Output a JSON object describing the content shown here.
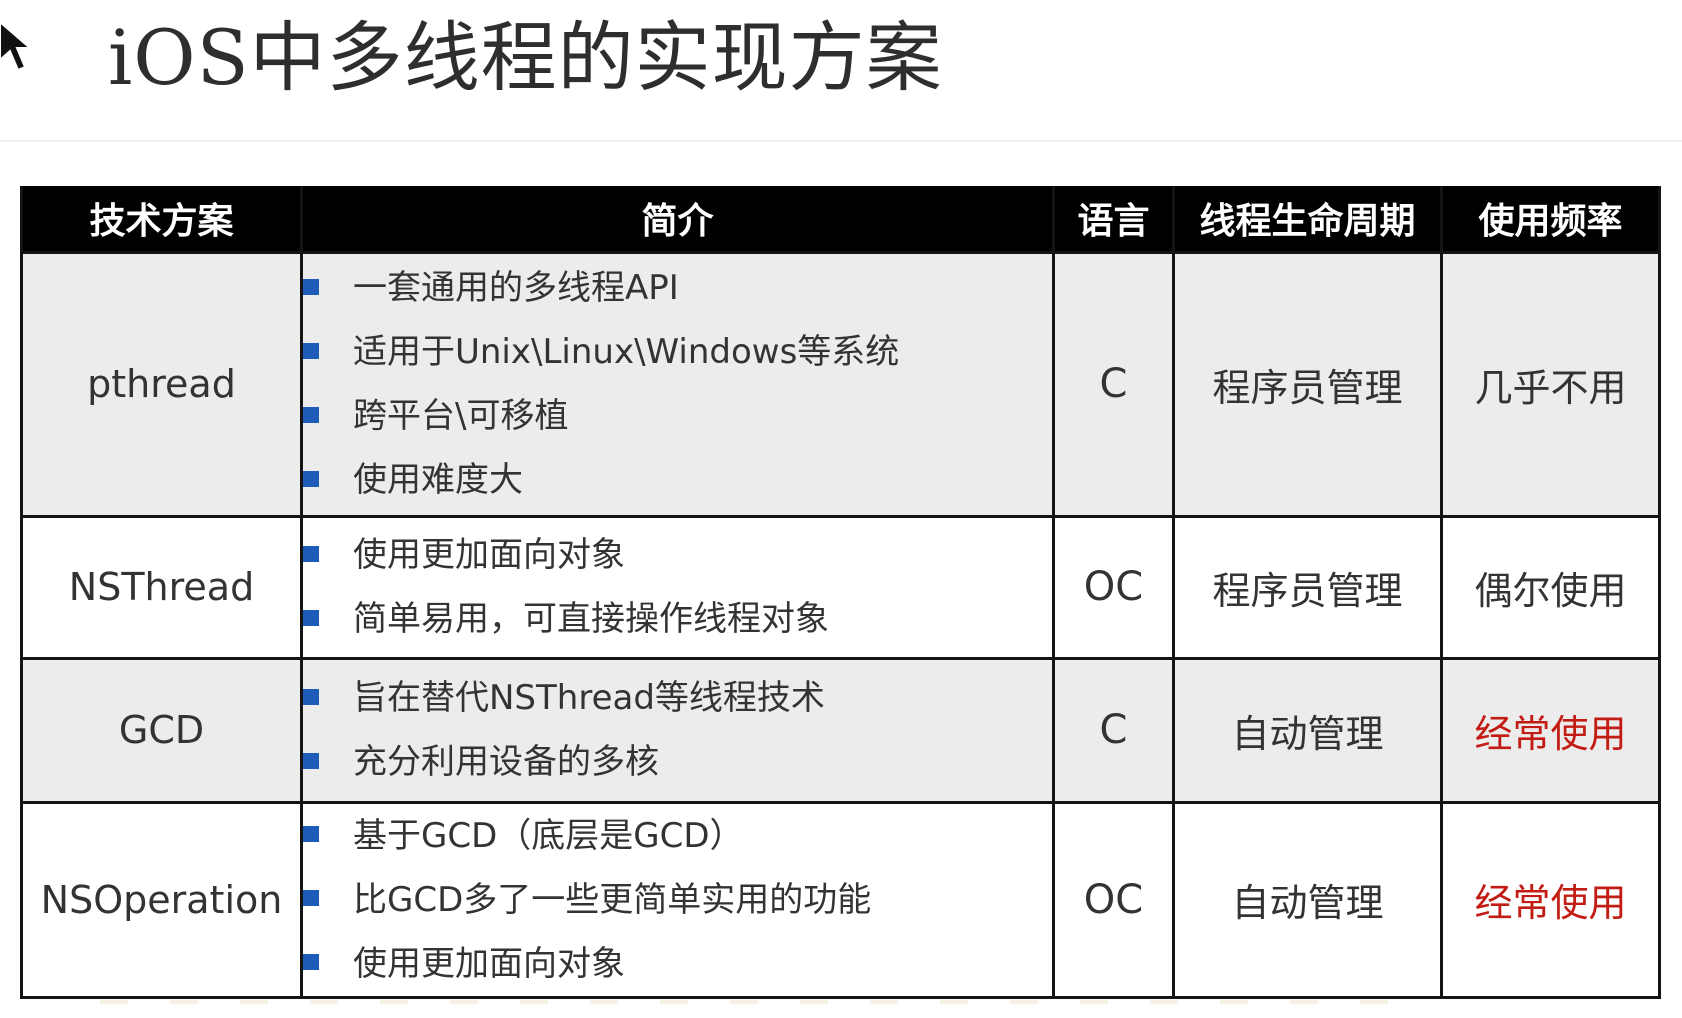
{
  "slide": {
    "title": "iOS中多线程的实现方案"
  },
  "table": {
    "headers": [
      "技术方案",
      "简介",
      "语言",
      "线程生命周期",
      "使用频率"
    ],
    "rows": [
      {
        "name": "pthread",
        "points": [
          "一套通用的多线程API",
          "适用于Unix\\Linux\\Windows等系统",
          "跨平台\\可移植",
          "使用难度大"
        ],
        "language": "C",
        "lifecycle": "程序员管理",
        "frequency": "几乎不用",
        "highlight": false
      },
      {
        "name": "NSThread",
        "points": [
          "使用更加面向对象",
          "简单易用，可直接操作线程对象"
        ],
        "language": "OC",
        "lifecycle": "程序员管理",
        "frequency": "偶尔使用",
        "highlight": false
      },
      {
        "name": "GCD",
        "points": [
          "旨在替代NSThread等线程技术",
          "充分利用设备的多核"
        ],
        "language": "C",
        "lifecycle": "自动管理",
        "frequency": "经常使用",
        "highlight": true
      },
      {
        "name": "NSOperation",
        "points": [
          "基于GCD（底层是GCD）",
          "比GCD多了一些更简单实用的功能",
          "使用更加面向对象"
        ],
        "language": "OC",
        "lifecycle": "自动管理",
        "frequency": "经常使用",
        "highlight": true
      }
    ]
  },
  "colors": {
    "header_bg": "#000000",
    "header_text": "#ffffff",
    "row_shaded": "#ececec",
    "bullet": "#1c5bb8",
    "highlight_text": "#c21c14",
    "body_text": "#333333"
  },
  "icons": {
    "cursor": "mouse-pointer-icon",
    "bullet": "square-bullet-icon"
  }
}
